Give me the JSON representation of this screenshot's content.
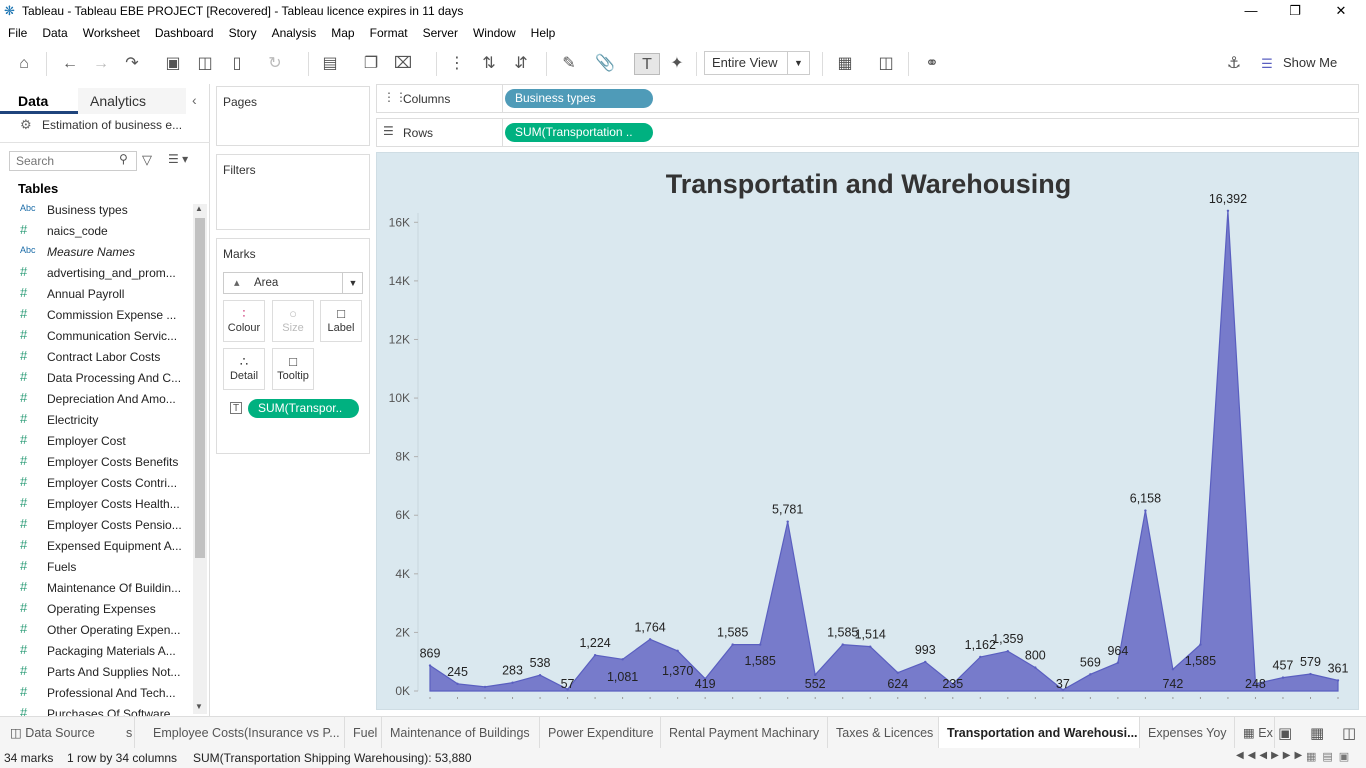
{
  "window": {
    "title": "Tableau - Tableau EBE PROJECT [Recovered] - Tableau licence expires in 11 days",
    "minimize": "—",
    "restore": "❐",
    "close": "✕"
  },
  "menu": [
    "File",
    "Data",
    "Worksheet",
    "Dashboard",
    "Story",
    "Analysis",
    "Map",
    "Format",
    "Server",
    "Window",
    "Help"
  ],
  "toolbar": {
    "fit_value": "Entire View",
    "show_me": "Show Me",
    "icons": [
      "home-icon",
      "undo-icon",
      "redo-icon",
      "swap-icon",
      "save-icon",
      "new-datasource-icon",
      "pause-icon",
      "refresh-icon",
      "new-worksheet-icon",
      "duplicate-icon",
      "clear-sheet-icon",
      "group-icon",
      "sort-asc-icon",
      "sort-desc-icon",
      "highlight-icon",
      "attach-icon",
      "labels-toggle-icon",
      "pin-icon",
      "chart-type-icon",
      "presentation-icon",
      "share-icon",
      "format-painter-icon",
      "show-me-icon"
    ]
  },
  "data_pane": {
    "tab_data": "Data",
    "tab_analytics": "Analytics",
    "datasource": "Estimation of business e...",
    "search_placeholder": "Search",
    "tables_header": "Tables",
    "fields": [
      {
        "type": "Abc",
        "name": "Business types",
        "italic": false
      },
      {
        "type": "#",
        "name": "naics_code",
        "italic": false
      },
      {
        "type": "Abc",
        "name": "Measure Names",
        "italic": true
      },
      {
        "type": "#",
        "name": "advertising_and_prom...",
        "italic": false
      },
      {
        "type": "#",
        "name": "Annual Payroll",
        "italic": false
      },
      {
        "type": "#",
        "name": "Commission Expense ...",
        "italic": false
      },
      {
        "type": "#",
        "name": "Communication Servic...",
        "italic": false
      },
      {
        "type": "#",
        "name": "Contract Labor Costs",
        "italic": false
      },
      {
        "type": "#",
        "name": "Data Processing And C...",
        "italic": false
      },
      {
        "type": "#",
        "name": "Depreciation And Amo...",
        "italic": false
      },
      {
        "type": "#",
        "name": "Electricity",
        "italic": false
      },
      {
        "type": "#",
        "name": "Employer Cost",
        "italic": false
      },
      {
        "type": "#",
        "name": "Employer Costs Benefits",
        "italic": false
      },
      {
        "type": "#",
        "name": "Employer Costs Contri...",
        "italic": false
      },
      {
        "type": "#",
        "name": "Employer Costs Health...",
        "italic": false
      },
      {
        "type": "#",
        "name": "Employer Costs Pensio...",
        "italic": false
      },
      {
        "type": "#",
        "name": "Expensed Equipment A...",
        "italic": false
      },
      {
        "type": "#",
        "name": "Fuels",
        "italic": false
      },
      {
        "type": "#",
        "name": "Maintenance Of Buildin...",
        "italic": false
      },
      {
        "type": "#",
        "name": "Operating Expenses",
        "italic": false
      },
      {
        "type": "#",
        "name": "Other Operating Expen...",
        "italic": false
      },
      {
        "type": "#",
        "name": "Packaging Materials A...",
        "italic": false
      },
      {
        "type": "#",
        "name": "Parts And Supplies Not...",
        "italic": false
      },
      {
        "type": "#",
        "name": "Professional And Tech...",
        "italic": false
      },
      {
        "type": "#",
        "name": "Purchases Of Software...",
        "italic": false
      }
    ]
  },
  "shelves": {
    "pages": "Pages",
    "filters": "Filters",
    "marks": "Marks",
    "mark_type": "Area",
    "mark_cards": [
      "Colour",
      "Size",
      "Label",
      "Detail",
      "Tooltip"
    ],
    "marks_pill": "SUM(Transpor..",
    "columns_label": "Columns",
    "columns_pill": "Business types",
    "rows_label": "Rows",
    "rows_pill": "SUM(Transportation .."
  },
  "colors": {
    "columns_pill": "#4f9bb8",
    "measure_pill": "#00b180",
    "area_fill": "#7275c8",
    "area_stroke": "#5a5fc0",
    "view_bg": "#dae8ef"
  },
  "chart_data": {
    "type": "area",
    "title": "Transportatin and Warehousing",
    "ylim": [
      0,
      17000
    ],
    "yticks": [
      0,
      2000,
      4000,
      6000,
      8000,
      10000,
      12000,
      14000,
      16000
    ],
    "ytick_labels": [
      "0K",
      "2K",
      "4K",
      "6K",
      "8K",
      "10K",
      "12K",
      "14K",
      "16K"
    ],
    "series": [
      {
        "values": [
          869,
          245,
          140,
          283,
          538,
          57,
          1224,
          1081,
          1764,
          1370,
          419,
          1585,
          1585,
          5781,
          552,
          1585,
          1514,
          624,
          993,
          235,
          1162,
          1359,
          800,
          37,
          569,
          964,
          6158,
          742,
          1585,
          16392,
          248,
          457,
          579,
          361
        ]
      }
    ],
    "point_labels": [
      "869",
      "245",
      "",
      "283",
      "538",
      "57",
      "1,224",
      "1,081",
      "1,764",
      "1,370",
      "419",
      "1,585",
      "1,585",
      "5,781",
      "552",
      "1,585",
      "1,514",
      "624",
      "993",
      "235",
      "1,162",
      "1,359",
      "800",
      "37",
      "569",
      "964",
      "6,158",
      "742",
      "1,585",
      "16,392",
      "248",
      "457",
      "579",
      "361"
    ]
  },
  "sheet_tabs": [
    "Data Source",
    "s",
    "Employee Costs(Insurance vs P...",
    "Fuel",
    "Maintenance of Buildings",
    "Power Expenditure",
    "Rental Payment Machinary",
    "Taxes & Licences",
    "Transportation and Warehousi...",
    "Expenses Yoy",
    "Ex"
  ],
  "active_tab": "Transportation and Warehousi...",
  "status": {
    "marks": "34 marks",
    "dims": "1 row  by  34 columns",
    "sum": "SUM(Transportation Shipping Warehousing): 53,880"
  }
}
